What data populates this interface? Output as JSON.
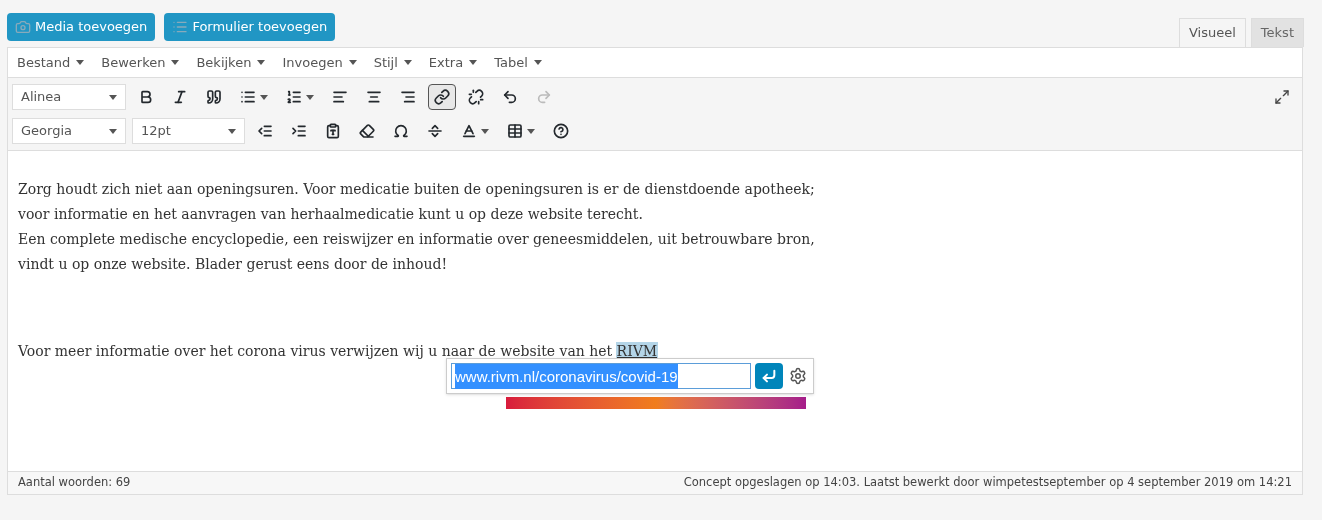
{
  "media_buttons": [
    "Media toevoegen",
    "Formulier toevoegen"
  ],
  "editor_tabs": [
    {
      "label": "Visueel",
      "selected": true
    },
    {
      "label": "Tekst",
      "selected": false
    }
  ],
  "menu": [
    "Bestand",
    "Bewerken",
    "Bekijken",
    "Invoegen",
    "Stijl",
    "Extra",
    "Tabel"
  ],
  "toolbar_row_1": [
    {
      "kind": "select",
      "value": "Alinea"
    },
    {
      "kind": "button",
      "pressed": false,
      "disabled": false
    },
    {
      "kind": "button",
      "pressed": false,
      "disabled": false
    },
    {
      "kind": "button",
      "pressed": false,
      "disabled": false
    },
    {
      "kind": "split",
      "pressed": false,
      "disabled": false
    },
    {
      "kind": "split",
      "pressed": false,
      "disabled": false
    },
    {
      "kind": "button",
      "pressed": false,
      "disabled": false
    },
    {
      "kind": "button",
      "pressed": false,
      "disabled": false
    },
    {
      "kind": "button",
      "pressed": false,
      "disabled": false
    },
    {
      "kind": "button",
      "pressed": true,
      "disabled": false
    },
    {
      "kind": "button",
      "pressed": false,
      "disabled": false
    },
    {
      "kind": "button",
      "pressed": false,
      "disabled": false
    },
    {
      "kind": "button",
      "pressed": false,
      "disabled": true
    }
  ],
  "toolbar_row_2": [
    {
      "kind": "select",
      "value": "Georgia"
    },
    {
      "kind": "wide-select",
      "value": "12pt"
    },
    {
      "kind": "button",
      "pressed": false,
      "disabled": false
    },
    {
      "kind": "button",
      "pressed": false,
      "disabled": false
    },
    {
      "kind": "button",
      "pressed": false,
      "disabled": false
    },
    {
      "kind": "button",
      "pressed": false,
      "disabled": false
    },
    {
      "kind": "button",
      "pressed": false,
      "disabled": false
    },
    {
      "kind": "button",
      "pressed": false,
      "disabled": false
    },
    {
      "kind": "split",
      "pressed": false,
      "disabled": false
    },
    {
      "kind": "split",
      "pressed": false,
      "disabled": false
    },
    {
      "kind": "button",
      "pressed": false,
      "disabled": false
    }
  ],
  "content": [
    {
      "kind": "paragraph",
      "text": "Zorg houdt zich niet aan openingsuren. Voor medicatie buiten de openingsuren is er de dienstdoende apotheek; voor informatie en het aanvragen van herhaalmedicatie kunt u op deze website terecht.\nEen complete medische encyclopedie, een reiswijzer en informatie over geneesmiddelen, uit betrouwbare bron, vindt u op onze website. Blader gerust eens door de inhoud!"
    },
    {
      "kind": "link-paragraph",
      "text": "Voor meer informatie over het corona virus verwijzen wij u naar de website van het ",
      "link": "RIVM",
      "link_selected": true
    }
  ],
  "link_popup": {
    "value": "www.rivm.nl/coronavirus/covid-19",
    "value_selected": true
  },
  "status_bar": {
    "word_count": "Aantal woorden: 69",
    "saved": "Concept opgeslagen op 14:03. Laatst bewerkt door wimpetestseptember op 4 september 2019 om 14:21"
  }
}
